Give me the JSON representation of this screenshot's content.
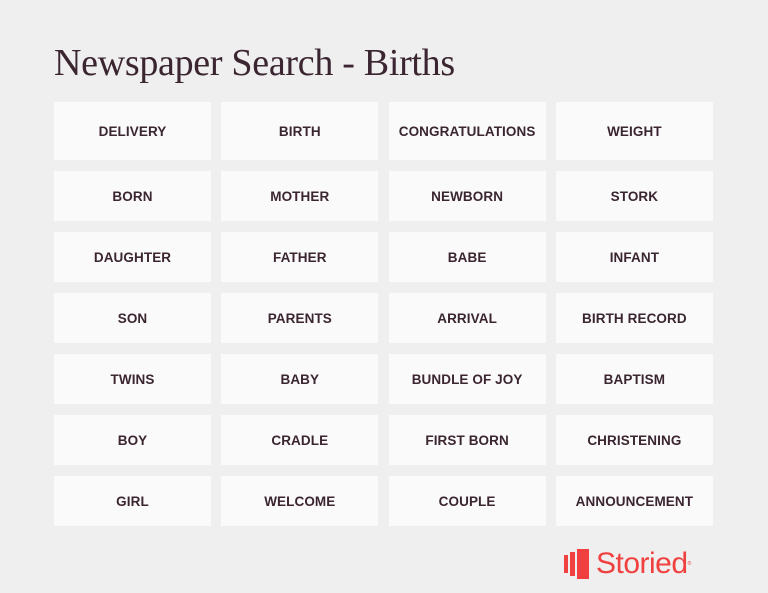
{
  "title": "Newspaper Search - Births",
  "keywords": [
    [
      "DELIVERY",
      "BIRTH",
      "CONGRATULATIONS",
      "WEIGHT"
    ],
    [
      "BORN",
      "MOTHER",
      "NEWBORN",
      "STORK"
    ],
    [
      "DAUGHTER",
      "FATHER",
      "BABE",
      "INFANT"
    ],
    [
      "SON",
      "PARENTS",
      "ARRIVAL",
      "BIRTH RECORD"
    ],
    [
      "TWINS",
      "BABY",
      "BUNDLE OF JOY",
      "BAPTISM"
    ],
    [
      "BOY",
      "CRADLE",
      "FIRST BORN",
      "CHRISTENING"
    ],
    [
      "GIRL",
      "WELCOME",
      "COUPLE",
      "ANNOUNCEMENT"
    ]
  ],
  "logo": {
    "text": "Storied",
    "trademark": "®",
    "icon": "storied-bars-icon",
    "color": "#f0403f"
  },
  "colors": {
    "background": "#efefef",
    "tile": "#fafafa",
    "text": "#3a2530"
  }
}
